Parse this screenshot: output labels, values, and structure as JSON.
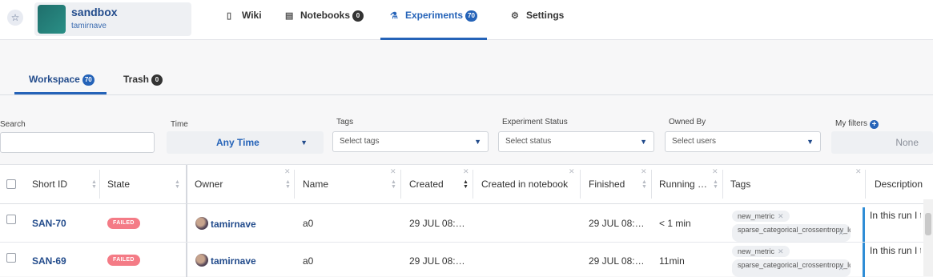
{
  "project": {
    "name": "sandbox",
    "owner": "tamirnave"
  },
  "nav_tabs": [
    {
      "label": "Wiki",
      "icon": "document-icon"
    },
    {
      "label": "Notebooks",
      "icon": "notebook-icon",
      "badge": "0"
    },
    {
      "label": "Experiments",
      "icon": "flask-icon",
      "badge": "70"
    },
    {
      "label": "Settings",
      "icon": "gear-icon"
    }
  ],
  "sub_tabs": [
    {
      "label": "Workspace",
      "badge": "70"
    },
    {
      "label": "Trash",
      "badge": "0"
    }
  ],
  "filters": {
    "search_label": "Search",
    "search_value": "",
    "time_label": "Time",
    "time_value": "Any Time",
    "tags_label": "Tags",
    "tags_placeholder": "Select tags",
    "status_label": "Experiment Status",
    "status_placeholder": "Select status",
    "owned_label": "Owned By",
    "owned_placeholder": "Select users",
    "my_filters_label": "My filters",
    "my_filters_value": "None"
  },
  "table": {
    "columns": [
      "Short ID",
      "State",
      "Owner",
      "Name",
      "Created",
      "Created in notebook",
      "Finished",
      "Running …",
      "Tags",
      "Description"
    ],
    "rows": [
      {
        "short_id": "SAN-70",
        "state": "FAILED",
        "owner": "tamirnave",
        "name": "a0",
        "created": "29 JUL 08:…",
        "created_in_notebook": "",
        "finished": "29 JUL 08:…",
        "running": "< 1 min",
        "tags": [
          "new_metric",
          "sparse_categorical_crossentropy_loss"
        ],
        "description": "In this run I t"
      },
      {
        "short_id": "SAN-69",
        "state": "FAILED",
        "owner": "tamirnave",
        "name": "a0",
        "created": "29 JUL 08:…",
        "created_in_notebook": "",
        "finished": "29 JUL 08:…",
        "running": "11min",
        "tags": [
          "new_metric",
          "sparse_categorical_crossentropy_loss"
        ],
        "description": "In this run I t"
      }
    ]
  },
  "colors": {
    "accent": "#2563b8",
    "dark_blue": "#234c8c",
    "failed": "#f47b86"
  }
}
